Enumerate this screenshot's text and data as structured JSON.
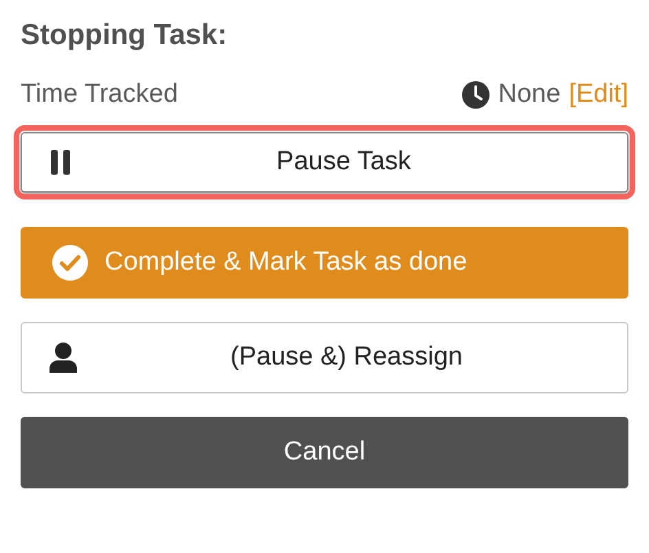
{
  "title": "Stopping Task:",
  "time_tracked": {
    "label": "Time Tracked",
    "value": "None",
    "edit_link": "[Edit]"
  },
  "buttons": [
    {
      "kind": "pause",
      "label": "Pause Task",
      "highlighted": true
    },
    {
      "kind": "complete",
      "label": "Complete & Mark Task as done",
      "highlighted": false
    },
    {
      "kind": "reassign",
      "label": "(Pause &) Reassign",
      "highlighted": false
    },
    {
      "kind": "cancel",
      "label": "Cancel",
      "highlighted": false
    }
  ]
}
